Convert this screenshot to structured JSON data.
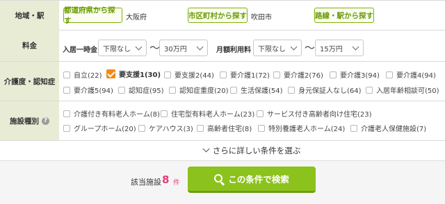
{
  "area": {
    "label": "地域・駅",
    "pref_button": "都道府県から探す",
    "pref_value": "大阪府",
    "city_button": "市区町村から探す",
    "city_value": "吹田市",
    "line_button": "路線・駅から探す"
  },
  "fee": {
    "label": "料金",
    "entry_label": "入居一時金",
    "entry_min": "下限なし",
    "entry_max": "30万円",
    "monthly_label": "月額利用料",
    "monthly_min": "下限なし",
    "monthly_max": "15万円",
    "tilde": "〜"
  },
  "care": {
    "label": "介護度・認知症",
    "items": [
      {
        "label": "自立(22)",
        "checked": false
      },
      {
        "label": "要支援1(30)",
        "checked": true
      },
      {
        "label": "要支援2(44)",
        "checked": false
      },
      {
        "label": "要介護1(72)",
        "checked": false
      },
      {
        "label": "要介護2(76)",
        "checked": false
      },
      {
        "label": "要介護3(94)",
        "checked": false
      },
      {
        "label": "要介護4(94)",
        "checked": false
      },
      {
        "label": "要介護5(94)",
        "checked": false
      },
      {
        "label": "認知症(95)",
        "checked": false
      },
      {
        "label": "認知症重度(20)",
        "checked": false
      },
      {
        "label": "生活保護(54)",
        "checked": false
      },
      {
        "label": "身元保証人なし(64)",
        "checked": false
      },
      {
        "label": "入居年齢相談可(50)",
        "checked": false
      }
    ]
  },
  "facility": {
    "label": "施設種別",
    "help": "?",
    "items": [
      {
        "label": "介護付き有料老人ホーム(8)"
      },
      {
        "label": "住宅型有料老人ホーム(23)"
      },
      {
        "label": "サービス付き高齢者向け住宅(23)"
      },
      {
        "label": "グループホーム(20)"
      },
      {
        "label": "ケアハウス(3)"
      },
      {
        "label": "高齢者住宅(8)"
      },
      {
        "label": "特別養護老人ホーム(24)"
      },
      {
        "label": "介護老人保健施設(7)"
      }
    ]
  },
  "more_conditions": "さらに詳しい条件を選ぶ",
  "footer": {
    "count_label": "該当施設",
    "count_value": "8",
    "count_unit": "件",
    "search_button": "この条件で検索"
  },
  "colors": {
    "label_bg": "#e8ecd5",
    "accent_green": "#8bc21c",
    "check_orange": "#f28a1a",
    "count_pink": "#e6397a"
  }
}
